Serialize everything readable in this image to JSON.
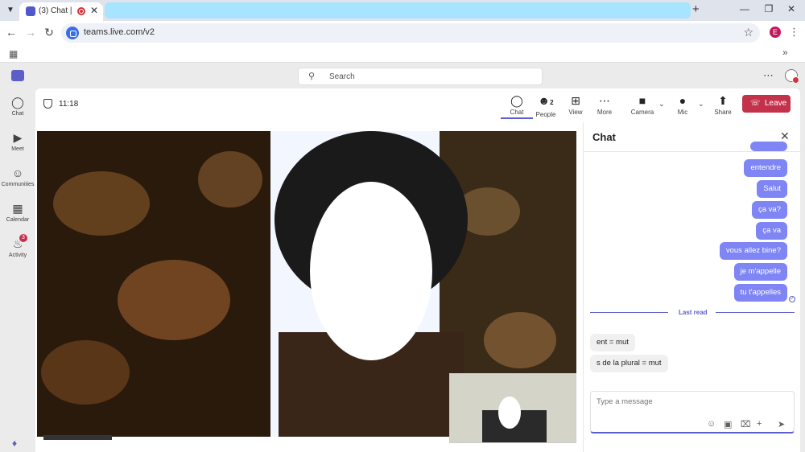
{
  "browser": {
    "tab": {
      "title": "(3) Chat |"
    },
    "url": "teams.live.com/v2",
    "profile_initial": "E",
    "icons": [
      "tab-search-icon",
      "new-tab-icon",
      "minimize-icon",
      "restore-icon",
      "window-close-icon",
      "back-icon",
      "forward-icon",
      "reload-icon",
      "star-icon",
      "apps-icon"
    ]
  },
  "search": {
    "placeholder": "Search"
  },
  "rail": {
    "items": [
      {
        "label": "Chat",
        "icon": "chat-icon"
      },
      {
        "label": "Meet",
        "icon": "meet-icon"
      },
      {
        "label": "Communities",
        "icon": "communities-icon"
      },
      {
        "label": "Calendar",
        "icon": "calendar-icon"
      },
      {
        "label": "Activity",
        "icon": "bell-icon",
        "badge": "3"
      }
    ]
  },
  "meeting": {
    "elapsed": "11:18",
    "toolbar": {
      "chat": "Chat",
      "people": "People",
      "people_count": "2",
      "view": "View",
      "more": "More",
      "camera": "Camera",
      "mic": "Mic",
      "share": "Share",
      "leave": "Leave"
    }
  },
  "chat": {
    "title": "Chat",
    "sent": [
      {
        "text": "entendre"
      },
      {
        "text": "Salut"
      },
      {
        "text": "ça va?"
      },
      {
        "text": "ça va"
      },
      {
        "text": "vous allez bine?"
      },
      {
        "text": "je m'appelle"
      },
      {
        "text": "tu t'appelles"
      }
    ],
    "last_read": "Last read",
    "received": [
      {
        "text": "ent = mut"
      },
      {
        "text": "s de la plural  = mut"
      }
    ],
    "composer_placeholder": "Type a message"
  },
  "colors": {
    "accent": "#5b5fc7",
    "sent_bubble": "#7f85f5",
    "leave": "#c4314b",
    "tab_highlight": "#a6e4ff"
  }
}
